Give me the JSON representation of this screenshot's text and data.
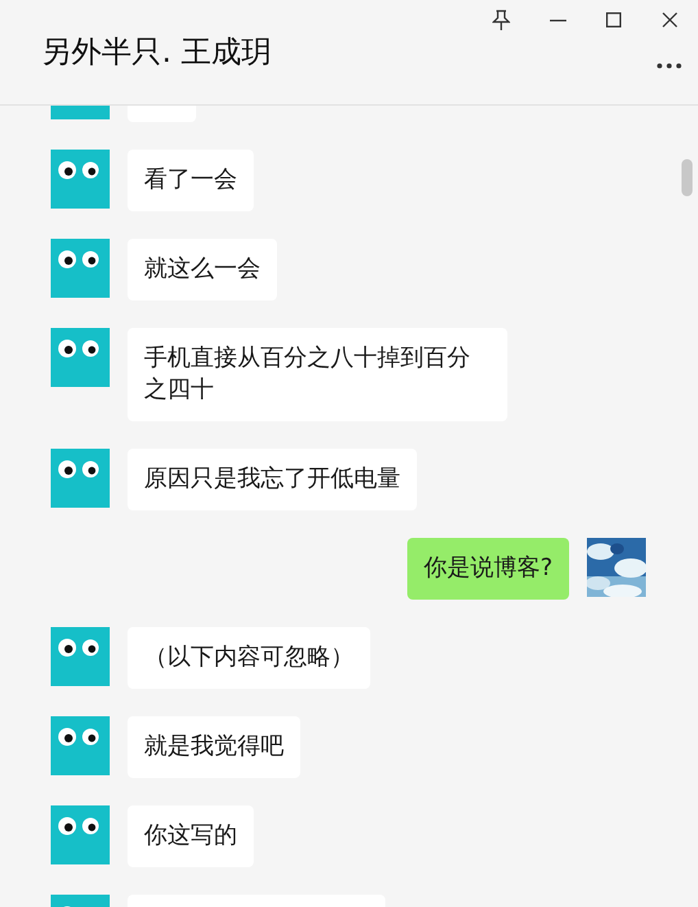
{
  "window": {
    "title": "另外半只. 王成玥"
  },
  "messages": [
    {
      "outgoing": false,
      "kind": "cut_top"
    },
    {
      "outgoing": false,
      "kind": "text",
      "text": "看了一会"
    },
    {
      "outgoing": false,
      "kind": "text",
      "text": "就这么一会"
    },
    {
      "outgoing": false,
      "kind": "text",
      "text": "手机直接从百分之八十掉到百分之四十"
    },
    {
      "outgoing": false,
      "kind": "text",
      "text": "原因只是我忘了开低电量"
    },
    {
      "outgoing": true,
      "kind": "text",
      "text": "你是说博客?"
    },
    {
      "outgoing": false,
      "kind": "text",
      "text": "（以下内容可忽略）"
    },
    {
      "outgoing": false,
      "kind": "text",
      "text": "就是我觉得吧"
    },
    {
      "outgoing": false,
      "kind": "text",
      "text": "你这写的"
    },
    {
      "outgoing": false,
      "kind": "cut_bottom"
    }
  ]
}
